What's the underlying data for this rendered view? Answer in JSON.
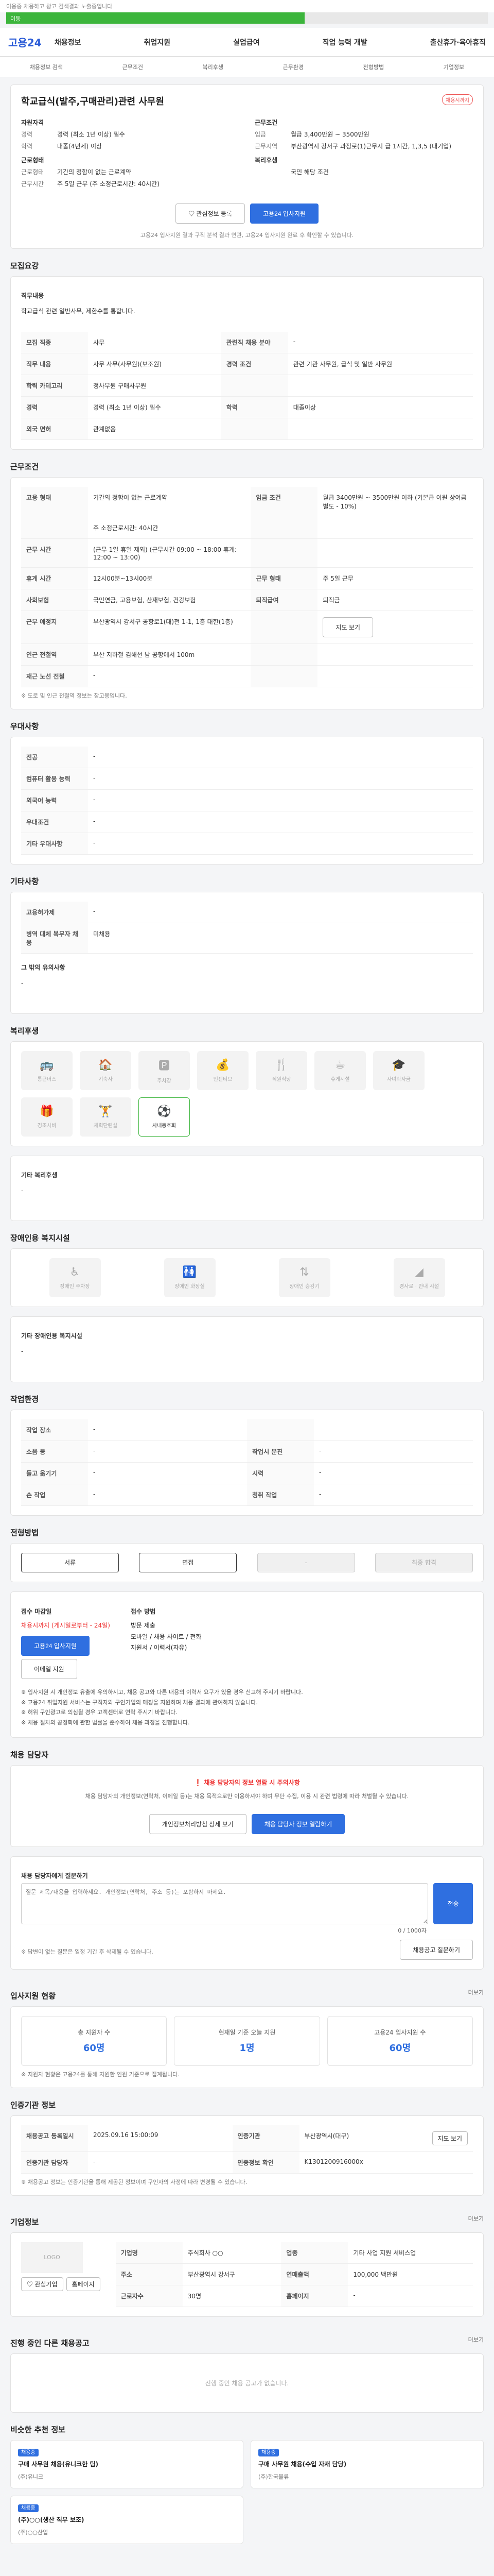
{
  "topnote": "이용중 채용하고 광고 검색결과 노출중입니다",
  "progress_label": "이동",
  "header": {
    "logo": "고용24",
    "nav": [
      "채용정보",
      "취업지원",
      "실업급여",
      "직업 능력 개발",
      "출산휴가·육아휴직"
    ]
  },
  "subnav": [
    "채용정보 검색",
    "근무조건",
    "복리후생",
    "근무환경",
    "전형방법",
    "기업정보"
  ],
  "job": {
    "badge": "채용시까지",
    "title": "학교급식(발주,구매관리)관련 사무원",
    "company": "",
    "left": {
      "h1": "자원자격",
      "k1": "경력",
      "v1": "경력 (최소 1년 이상) 필수",
      "k2": "학력",
      "v2": "대졸(4년제) 이상",
      "h2": "근로형태",
      "k3": "근로형태",
      "v3": "기간의 정함이 없는 근로계약",
      "k4": "근무시간",
      "v4": "주 5일 근무 (주 소정근로시간: 40시간)"
    },
    "right": {
      "h1": "근무조건",
      "k1": "임금",
      "v1": "월급 3,400만원 ~ 3500만원",
      "k2": "근무지역",
      "v2": "부산광역시 강서구 과정로(1)근무시 급 1시간, 1,3,5 (대기업)",
      "h2": "복리후생",
      "k3": "",
      "v3": "국민 해당 조건"
    },
    "scrap_btn": "관심정보 등록",
    "apply_btn": "고용24 입사지원",
    "notice": "고용24 입사지원 결과 구직 분석 결과 연관, 고용24 입사지원 완료 후 확인할 수 있습니다."
  },
  "recruit": {
    "title": "모집요강",
    "desc_title": "직무내용",
    "desc": "학교급식 관련 일반사무, 제한수를 통합니다.",
    "rows": [
      [
        "모집 직종",
        "사무",
        "관련직 채용 분야",
        "-"
      ],
      [
        "직무 내용",
        "사무 사무(사무원)(보조원)",
        "경력 조건",
        "관련 기관 사무원, 급식 및 일반 사무원"
      ],
      [
        "학력 카테고리",
        "정사무원 구매사무원",
        "",
        ""
      ],
      [
        "경력",
        "경력 (최소 1년 이상) 필수",
        "학력",
        "대졸이상"
      ],
      [
        "외국 면허",
        "관계없음",
        "",
        ""
      ]
    ]
  },
  "conditions": {
    "title": "근무조건",
    "rows": [
      [
        "고용 형태",
        "기간의 정함이 없는 근로계약",
        "임금 조건",
        "월급 3400만원 ~ 3500만원 이하 (기본급 이원 상여금 별도 - 10%)"
      ],
      [
        "",
        "주 소정근로시간: 40시간",
        "",
        ""
      ],
      [
        "근무 시간",
        "(근무 1일 휴일 제외)\n(근무시간 09:00 ~ 18:00 휴게: 12:00 ~ 13:00)",
        "",
        ""
      ],
      [
        "휴게 시간",
        "12시00분~13시00분",
        "근무 형태",
        "주 5일 근무"
      ],
      [
        "사회보험",
        "국민연금, 고용보험, 산재보험, 건강보험",
        "퇴직급여",
        "퇴직금"
      ],
      [
        "근무 예정지",
        "부산광역시 강서구 공항로1(대)전 1-1, 1층 대한(1층)",
        "",
        ""
      ],
      [
        "인근 전철역",
        "부산 지하철 김해선 남 공항에서 100m",
        "",
        ""
      ],
      [
        "재근 노선 전철",
        "-",
        "",
        ""
      ]
    ],
    "note": "※ 도로 및 인근 전철역 정보는 참고용입니다.",
    "map_btn": "지도 보기"
  },
  "prefer": {
    "title": "우대사항",
    "rows": [
      [
        "전공",
        "-"
      ],
      [
        "컴퓨터 활용 능력",
        "-"
      ],
      [
        "외국어 능력",
        "-"
      ],
      [
        "우대조건",
        "-"
      ],
      [
        "기타 우대사항",
        "-"
      ]
    ]
  },
  "etc": {
    "title": "기타사항",
    "rows": [
      [
        "고용허가제",
        "-"
      ],
      [
        "병역 대체 복무자 채용",
        "미채용"
      ]
    ],
    "desc_title": "그 밖의 유의사항",
    "desc": "-"
  },
  "welfare": {
    "title": "복리후생",
    "items": [
      "통근버스",
      "기숙사",
      "주차장",
      "인센티브",
      "직원식당",
      "휴게시설",
      "자녀학자금",
      "경조사비",
      "체력단련실",
      "사내동호회"
    ],
    "on_index": 9,
    "etc_title": "기타 복리후생",
    "etc_desc": "-"
  },
  "disability": {
    "title": "장애인용 복지시설",
    "items": [
      "장애인 주차장",
      "장애인 화장실",
      "장애인 승강기",
      "경사로 · 안내 시설"
    ],
    "etc_title": "기타 장애인용 복지시설",
    "etc_desc": "-"
  },
  "env": {
    "title": "작업환경",
    "rows": [
      [
        "작업 장소",
        "-",
        "",
        ""
      ],
      [
        "소음 등",
        "-",
        "작업시 분진",
        "-"
      ],
      [
        "들고 옮기기",
        "-",
        "시력",
        "-"
      ],
      [
        "손 작업",
        "-",
        "청취 작업",
        "-"
      ]
    ]
  },
  "process": {
    "title": "전형방법",
    "steps": [
      "서류",
      "면접",
      "-",
      "최종 합격"
    ],
    "left_title": "접수 마감일",
    "left_lines": [
      "채용시까지 (게시일로부터 - 24일)",
      "고용24 입사지원",
      "이메일 지원"
    ],
    "right_title": "접수 방법",
    "right_lines": [
      "방문 제출",
      "모바일 / 채용 사이트 / 전화",
      "지원서 / 이력서(자유)"
    ],
    "notes": [
      "※ 입사지원 시 개인정보 유출에 유의하시고, 채용 공고와 다른 내용의 이력서 요구가 있을 경우 신고해 주시기 바랍니다.",
      "※ 고용24 취업지원 서비스는 구직자와 구인기업의 매칭을 지원하며 채용 결과에 관여하지 않습니다.",
      "※ 허위 구인광고로 의심될 경우 고객센터로 연락 주시기 바랍니다.",
      "※ 채용 절차의 공정화에 관한 법률을 준수하여 채용 과정을 진행합니다."
    ]
  },
  "contact": {
    "title": "채용 담당자",
    "alert": "채용 담당자의 정보 열람 시 주의사항",
    "desc": "채용 담당자의 개인정보(연락처, 이메일 등)는 채용 목적으로만 이용하셔야 하며 무단 수집, 이용 시 관련 법령에 따라 처벌될 수 있습니다.",
    "btn1": "개인정보처리방침 상세 보기",
    "btn2": "채용 담당자 정보 열람하기",
    "qa_title": "채용 담당자에게 질문하기",
    "qa_note": "",
    "qa_placeholder": "질문 제목/내용을 입력하세요. 개인정보(연락처, 주소 등)는 포함하지 마세요.",
    "qa_btn": "전송",
    "qa_count": "0 / 1000자",
    "qa_footer": "※ 답변이 없는 질문은 일정 기간 후 삭제될 수 있습니다.",
    "qa_more_btn": "채용공고 질문하기"
  },
  "stats": {
    "title": "입사지원 현황",
    "more": "더보기",
    "items": [
      {
        "label": "총 지원자 수",
        "value": "60명"
      },
      {
        "label": "현재일 기준 오늘 지원",
        "value": "1명"
      },
      {
        "label": "고용24 입사지원 수",
        "value": "60명"
      }
    ],
    "note": "※ 지원자 현황은 고용24를 통해 지원한 인원 기준으로 집계됩니다."
  },
  "info": {
    "title": "인증기관 정보",
    "rows": [
      [
        "채용공고 등록일시",
        "2025.09.16 15:00:09",
        "인증기관",
        "부산광역시(대구)"
      ],
      [
        "인증기관 담당자",
        "-",
        "인증정보 확인",
        "K1301200916000x"
      ]
    ],
    "map_btn": "지도 보기",
    "note": "※ 채용공고 정보는 인증기관을 통해 제공된 정보이며 구인자의 사정에 따라 변경될 수 있습니다."
  },
  "company": {
    "title": "기업정보",
    "more": "더보기",
    "logo": "LOGO",
    "btn1": "관심기업",
    "btn2": "홈페이지",
    "rows": [
      [
        "기업명",
        "주식회사 ○○",
        "업종",
        "기타 사업 지원 서비스업"
      ],
      [
        "주소",
        "부산광역시 강서구",
        "연매출액",
        "100,000 백만원"
      ],
      [
        "근로자수",
        "30명",
        "홈페이지",
        "-"
      ]
    ]
  },
  "others": {
    "title": "진행 중인 다른 채용공고",
    "more": "더보기",
    "empty": "진행 중인 채용 공고가 없습니다."
  },
  "similar": {
    "title": "비슷한 추천 정보",
    "cards": [
      {
        "tag": "채용중",
        "title": "구매 사무원 채용(유니크한 팀)",
        "company": "(주)유니크"
      },
      {
        "tag": "채용중",
        "title": "구매 사무원 채용(수입 자재 담당)",
        "company": "(주)한국물류"
      },
      {
        "tag": "채용중",
        "title": "(주)○○(생산 직무 보조)",
        "company": "(주)○○산업"
      }
    ]
  }
}
